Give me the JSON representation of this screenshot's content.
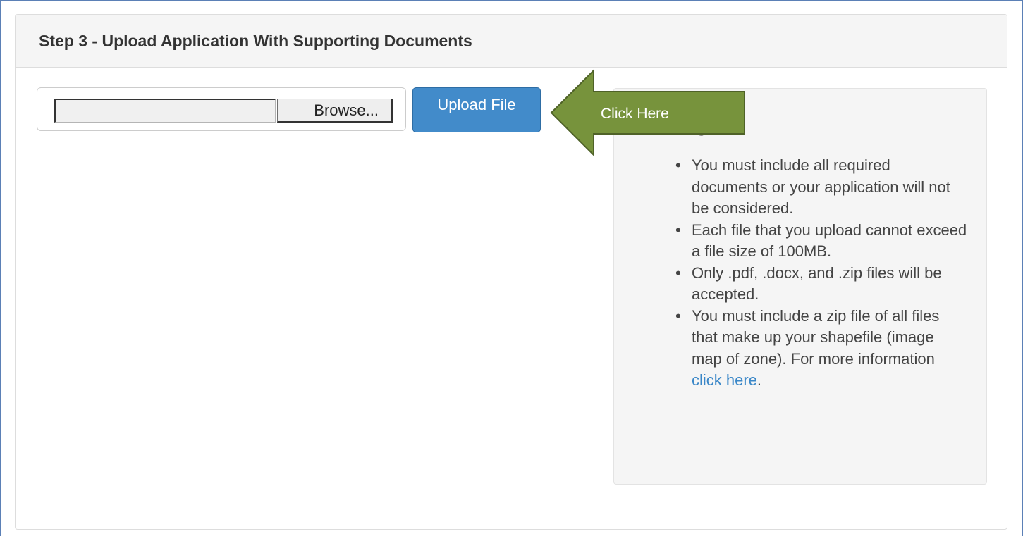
{
  "panel": {
    "title": "Step 3 - Upload Application With Supporting Documents"
  },
  "upload_form": {
    "file_path_value": "",
    "browse_label": "Browse...",
    "upload_label": "Upload File"
  },
  "callout": {
    "label": "Click Here",
    "color": "#77933c"
  },
  "info": {
    "title_visible": "ading",
    "items": [
      {
        "text": "You must include all required documents or your application will not be considered."
      },
      {
        "text": "Each file that you upload cannot exceed a file size of 100MB."
      },
      {
        "text": "Only .pdf, .docx, and .zip files will be accepted."
      },
      {
        "text": "You must include a zip file of all files that make up your shapefile (image map of zone). For more information ",
        "link": "click here",
        "suffix": "."
      }
    ]
  },
  "colors": {
    "primary_button": "#428bca",
    "link": "#3a87c8",
    "panel_heading_bg": "#f5f5f5",
    "well_bg": "#f5f5f5"
  }
}
